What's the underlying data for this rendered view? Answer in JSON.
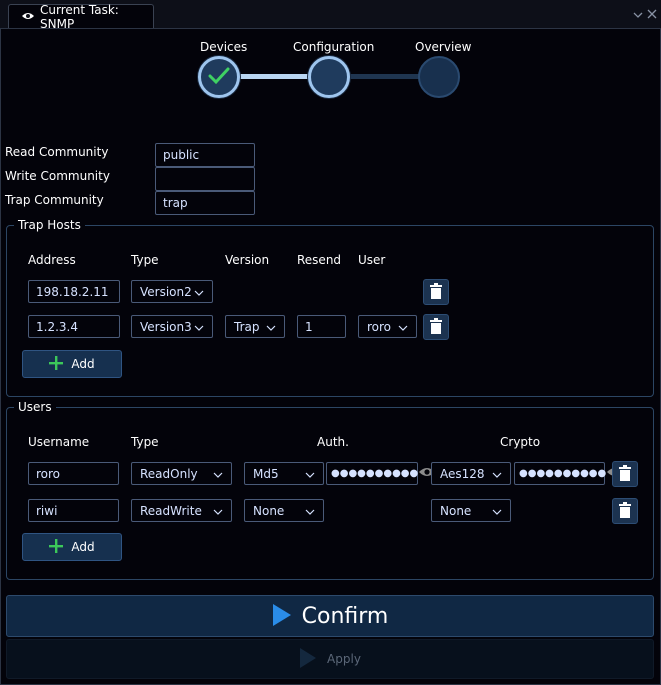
{
  "window": {
    "tab_title": "Current Task: SNMP"
  },
  "stepper": {
    "steps": [
      {
        "label": "Devices",
        "state": "done"
      },
      {
        "label": "Configuration",
        "state": "current"
      },
      {
        "label": "Overview",
        "state": "pending"
      }
    ]
  },
  "community": {
    "read_label": "Read Community",
    "read_value": "public",
    "write_label": "Write Community",
    "write_value": "",
    "trap_label": "Trap Community",
    "trap_value": "trap"
  },
  "trap_hosts": {
    "title": "Trap Hosts",
    "headers": {
      "address": "Address",
      "type": "Type",
      "version": "Version",
      "resend": "Resend",
      "user": "User"
    },
    "rows": [
      {
        "address": "198.18.2.11",
        "type": "Version2",
        "version": "",
        "resend": "",
        "user": ""
      },
      {
        "address": "1.2.3.4",
        "type": "Version3",
        "version": "Trap",
        "resend": "1",
        "user": "roro"
      }
    ],
    "add_label": "Add"
  },
  "users": {
    "title": "Users",
    "headers": {
      "username": "Username",
      "type": "Type",
      "auth": "Auth.",
      "crypto": "Crypto"
    },
    "rows": [
      {
        "username": "roro",
        "type": "ReadOnly",
        "auth": "Md5",
        "auth_password": "●●●●●●●●●●",
        "crypto": "Aes128",
        "crypto_password": "●●●●●●●●●●"
      },
      {
        "username": "riwi",
        "type": "ReadWrite",
        "auth": "None",
        "crypto": "None"
      }
    ],
    "add_label": "Add"
  },
  "actions": {
    "confirm_label": "Confirm",
    "apply_label": "Apply"
  },
  "colors": {
    "accent": "#2a8ce8",
    "background": "#03030a",
    "add_plus": "#3cc85a"
  },
  "icons": [
    "eye-icon",
    "chevron-down-icon",
    "close-icon",
    "check-icon",
    "trash-icon",
    "plus-icon",
    "play-icon"
  ]
}
